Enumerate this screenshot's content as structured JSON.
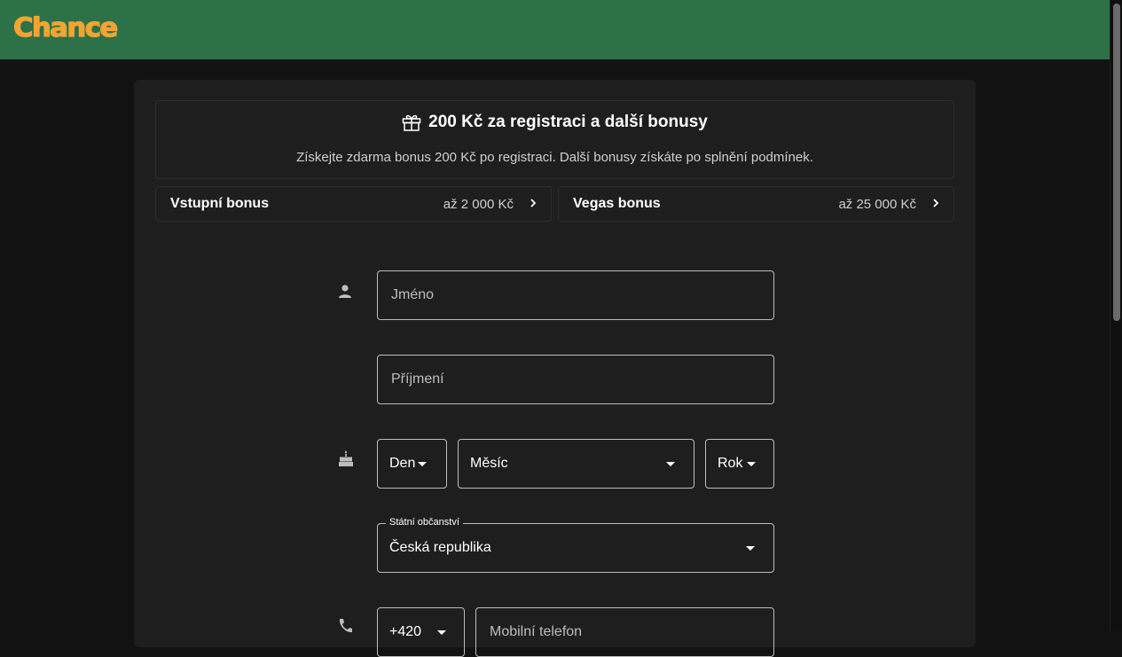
{
  "header": {
    "logo_text": "Chance",
    "brand_color": "#2d7148",
    "logo_color": "#f2a532"
  },
  "promo": {
    "icon": "gift-icon",
    "title": "200 Kč za registraci a další bonusy",
    "subtitle": "Získejte zdarma bonus 200 Kč po registraci. Další bonusy získáte po splnění podmínek."
  },
  "bonuses": [
    {
      "name": "Vstupní bonus",
      "amount": "až 2 000 Kč",
      "icon": "chevron-right-icon"
    },
    {
      "name": "Vegas bonus",
      "amount": "až 25 000 Kč",
      "icon": "chevron-right-icon"
    }
  ],
  "form": {
    "first_name_placeholder": "Jméno",
    "last_name_placeholder": "Příjmení",
    "day_label": "Den",
    "month_label": "Měsíc",
    "year_label": "Rok",
    "citizenship_label": "Státní občanství",
    "citizenship_value": "Česká republika",
    "phone_prefix": "+420",
    "phone_placeholder": "Mobilní telefon",
    "icons": [
      "person-icon",
      "cake-icon",
      "phone-icon"
    ]
  }
}
